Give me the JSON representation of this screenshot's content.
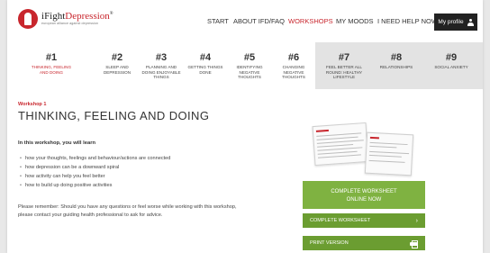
{
  "brand": {
    "name_prefix": "i",
    "name_main": "Fight",
    "name_red": "Depression",
    "registered": "®",
    "tagline": "european alliance against depression"
  },
  "nav": {
    "items": [
      "START",
      "ABOUT IFD/FAQ",
      "WORKSHOPS",
      "MY MOODS",
      "I NEED HELP NOW"
    ],
    "active": "WORKSHOPS",
    "profile_label": "My profile"
  },
  "tabs": [
    {
      "num": "#1",
      "label": "THINKING, FEELING AND DOING",
      "active": true
    },
    {
      "num": "#2",
      "label": "SLEEP AND DEPRESSION"
    },
    {
      "num": "#3",
      "label": "PLANNING AND DOING ENJOYABLE THINGS"
    },
    {
      "num": "#4",
      "label": "GETTING THINGS DONE"
    },
    {
      "num": "#5",
      "label": "IDENTIFYING NEGATIVE THOUGHTS"
    },
    {
      "num": "#6",
      "label": "CHANGING NEGATIVE THOUGHTS"
    },
    {
      "num": "#7",
      "label": "FEEL BETTER ALL ROUND: HEALTHY LIFESTYLE"
    },
    {
      "num": "#8",
      "label": "RELATIONSHIPS"
    },
    {
      "num": "#9",
      "label": "SOCIAL ANXIETY"
    }
  ],
  "content": {
    "kicker": "Workshop 1",
    "title": "THINKING, FEELING AND DOING",
    "intro": "In this workshop, you will learn",
    "bullets": [
      "how your thoughts, feelings and behaviour/actions are connected",
      "how depression can be a downward spiral",
      "how activity can help you feel better",
      "how to build up doing positive activities"
    ],
    "note": "Please remember: Should you have any questions or feel worse while working with this workshop, please contact your guiding health professional to ask for advice."
  },
  "worksheet": {
    "panel_line1": "COMPLETE WORKSHEET",
    "panel_line2": "ONLINE NOW",
    "complete_label": "COMPLETE WORKSHEET",
    "print_label": "PRINT VERSION",
    "chevron": "›"
  },
  "colors": {
    "accent_red": "#c8262d",
    "green": "#7fb241",
    "green_dark": "#6b9d31",
    "tab_bg": "#e3e3e3"
  }
}
